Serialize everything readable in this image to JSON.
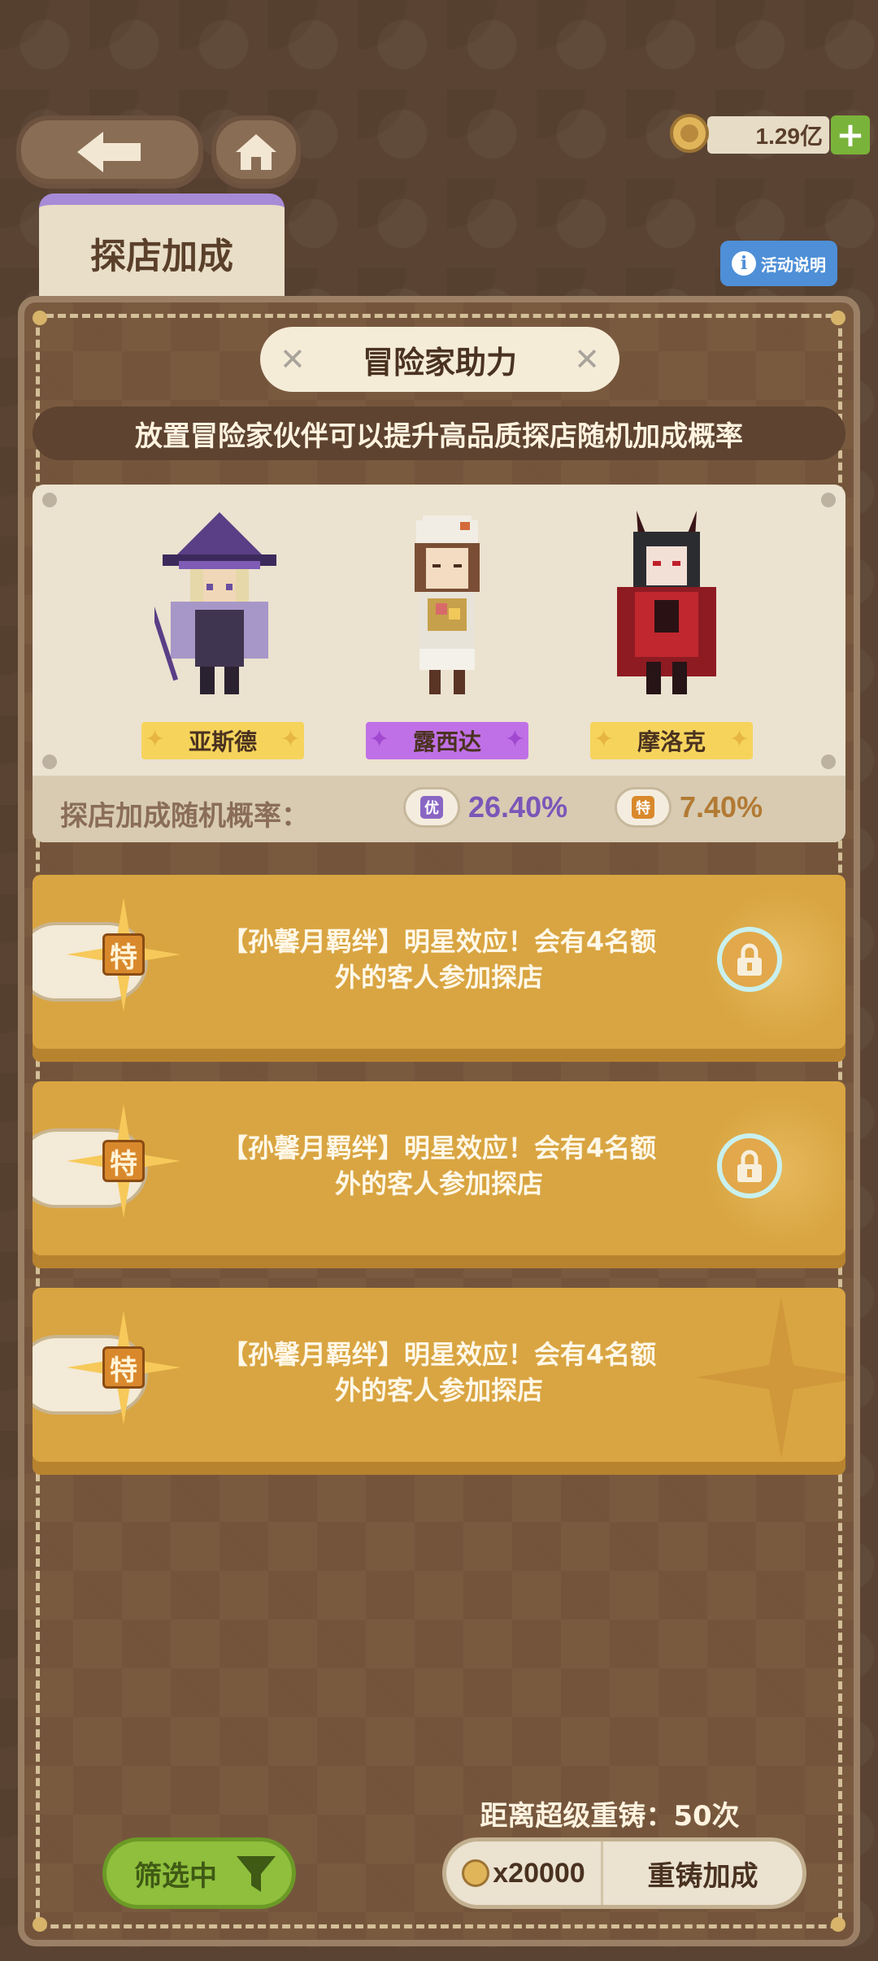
{
  "header": {
    "back_icon": "arrow-left-icon",
    "home_icon": "home-icon",
    "currency_amount": "1.29亿",
    "add_label": "+"
  },
  "tab": {
    "label": "探店加成"
  },
  "info_button": {
    "icon": "i",
    "label": "活动说明"
  },
  "panel": {
    "title": "冒险家助力",
    "subtitle": "放置冒险家伙伴可以提升高品质探店随机加成概率"
  },
  "characters": [
    {
      "name": "亚斯德",
      "tag_color": "#f6d45c",
      "spark_color": "#e7b642"
    },
    {
      "name": "露西达",
      "tag_color": "#c070e6",
      "spark_color": "#a048d0"
    },
    {
      "name": "摩洛克",
      "tag_color": "#f6d45c",
      "spark_color": "#e7b642"
    }
  ],
  "rates": {
    "label": "探店加成随机概率：",
    "items": [
      {
        "badge": "优",
        "value": "26.40%",
        "color": "#7b56b8",
        "badge_color": "#8a66c4"
      },
      {
        "badge": "特",
        "value": "7.40%",
        "color": "#b27a34",
        "badge_color": "#d9892c"
      }
    ]
  },
  "bonuses": [
    {
      "badge": "特",
      "line1": "【孙馨月羁绊】明星效应！会有4名额",
      "line2": "外的客人参加探店",
      "locked": true
    },
    {
      "badge": "特",
      "line1": "【孙馨月羁绊】明星效应！会有4名额",
      "line2": "外的客人参加探店",
      "locked": true
    },
    {
      "badge": "特",
      "line1": "【孙馨月羁绊】明星效应！会有4名额",
      "line2": "外的客人参加探店",
      "locked": false
    }
  ],
  "footer": {
    "reforge_distance": "距离超级重铸：50次",
    "filter_label": "筛选中",
    "cost": "x20000",
    "reforge_label": "重铸加成"
  }
}
